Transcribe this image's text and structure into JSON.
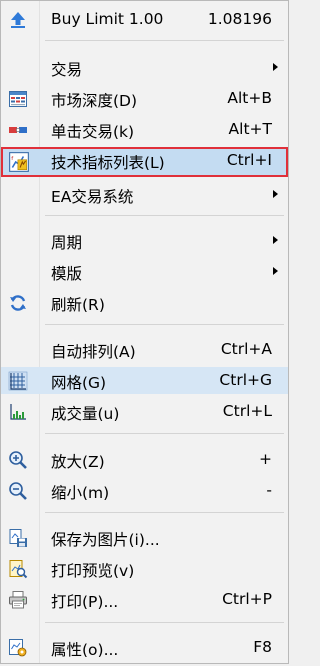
{
  "menu": {
    "items": [
      {
        "label": "Buy Limit 1.00",
        "shortcut": "1.08196",
        "icon": "up-arrow-icon"
      },
      {
        "label": "交易",
        "submenu": true
      },
      {
        "label": "市场深度(D)",
        "shortcut": "Alt+B",
        "icon": "market-depth-icon"
      },
      {
        "label": "单击交易(k)",
        "shortcut": "Alt+T",
        "icon": "one-click-trading-icon"
      },
      {
        "label": "技术指标列表(L)",
        "shortcut": "Ctrl+I",
        "icon": "indicators-list-icon",
        "highlighted": true
      },
      {
        "label": "EA交易系统",
        "submenu": true
      },
      {
        "label": "周期",
        "submenu": true
      },
      {
        "label": "模版",
        "submenu": true
      },
      {
        "label": "刷新(R)",
        "icon": "refresh-icon"
      },
      {
        "label": "自动排列(A)",
        "shortcut": "Ctrl+A"
      },
      {
        "label": "网格(G)",
        "shortcut": "Ctrl+G",
        "icon": "grid-icon"
      },
      {
        "label": "成交量(u)",
        "shortcut": "Ctrl+L",
        "icon": "volumes-icon"
      },
      {
        "label": "放大(Z)",
        "shortcut": "+",
        "icon": "zoom-in-icon"
      },
      {
        "label": "缩小(m)",
        "shortcut": "-",
        "icon": "zoom-out-icon"
      },
      {
        "label": "保存为图片(i)...",
        "icon": "save-as-picture-icon"
      },
      {
        "label": "打印预览(v)",
        "icon": "print-preview-icon"
      },
      {
        "label": "打印(P)...",
        "shortcut": "Ctrl+P",
        "icon": "print-icon"
      },
      {
        "label": "属性(o)...",
        "shortcut": "F8",
        "icon": "properties-icon"
      }
    ]
  },
  "colors": {
    "highlight_bg": "#c4dcf2",
    "highlight_border": "#e0303a",
    "menu_bg": "#f2f2f2"
  }
}
